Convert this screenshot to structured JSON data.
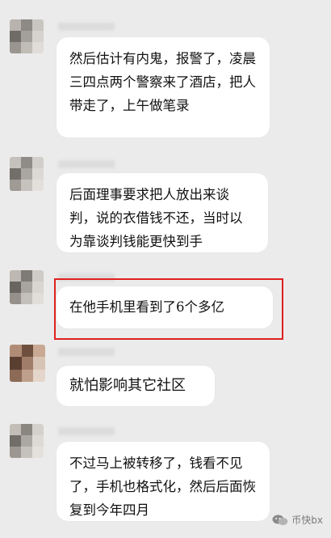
{
  "messages": [
    {
      "text": "然后估计有内鬼，报警了，凌晨三四点两个警察来了酒店，把人带走了，上午做笔录"
    },
    {
      "text": "后面理事要求把人放出来谈判，说的衣借钱不还，当时以为靠谈判钱能更快到手"
    },
    {
      "text": "在他手机里看到了6个多亿"
    },
    {
      "text": "就怕影响其它社区"
    },
    {
      "text": "不过马上被转移了，钱看不见了，手机也格式化，然后后面恢复到今年四月"
    }
  ],
  "watermark": {
    "icon": "wechat-icon",
    "label": "币快bx"
  },
  "colors": {
    "background": "#ebebeb",
    "bubble": "#ffffff",
    "highlight_border": "#e02020"
  }
}
